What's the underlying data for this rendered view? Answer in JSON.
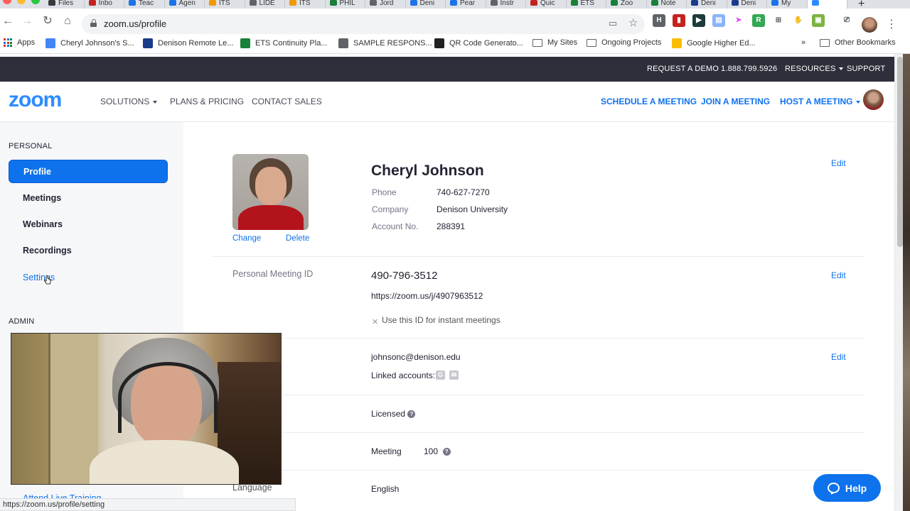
{
  "browser": {
    "tabs": [
      {
        "label": "Files",
        "color": "#3a3a3a"
      },
      {
        "label": "Inbo",
        "color": "#c5221f"
      },
      {
        "label": "Teac",
        "color": "#1a73e8"
      },
      {
        "label": "Agen",
        "color": "#1a73e8"
      },
      {
        "label": "ITS",
        "color": "#f29900"
      },
      {
        "label": "LIDE",
        "color": "#5f6368"
      },
      {
        "label": "ITS",
        "color": "#f29900"
      },
      {
        "label": "PHIL",
        "color": "#188038"
      },
      {
        "label": "Jord",
        "color": "#5f6368"
      },
      {
        "label": "Deni",
        "color": "#1a73e8"
      },
      {
        "label": "Pear",
        "color": "#1a73e8"
      },
      {
        "label": "Instr",
        "color": "#5f6368"
      },
      {
        "label": "Quic",
        "color": "#c5221f"
      },
      {
        "label": "ETS",
        "color": "#188038"
      },
      {
        "label": "Zoo",
        "color": "#188038"
      },
      {
        "label": "Note",
        "color": "#188038"
      },
      {
        "label": "Deni",
        "color": "#1a3a8a"
      },
      {
        "label": "Deni",
        "color": "#1a3a8a"
      },
      {
        "label": "My",
        "color": "#1a73e8"
      },
      {
        "label": "",
        "color": "#2d8cff"
      }
    ],
    "url": "zoom.us/profile",
    "bookmarks": [
      {
        "label": "Apps"
      },
      {
        "label": "Cheryl Johnson's S...",
        "color": "#4285f4"
      },
      {
        "label": "Denison Remote Le...",
        "color": "#1a3a8a"
      },
      {
        "label": "ETS Continuity Pla...",
        "color": "#188038"
      },
      {
        "label": "SAMPLE RESPONS...",
        "color": "#5f6368"
      },
      {
        "label": "QR Code Generato...",
        "color": "#222"
      },
      {
        "label": "My Sites"
      },
      {
        "label": "Ongoing Projects"
      },
      {
        "label": "Google Higher Ed...",
        "color": "#fbbc04"
      },
      {
        "label": "»"
      },
      {
        "label": "Other Bookmarks"
      }
    ],
    "status_url": "https://zoom.us/profile/setting"
  },
  "topbar": {
    "request_demo": "REQUEST A DEMO",
    "phone": "1.888.799.5926",
    "resources": "RESOURCES",
    "support": "SUPPORT"
  },
  "nav": {
    "logo": "zoom",
    "solutions": "SOLUTIONS",
    "plans": "PLANS & PRICING",
    "contact": "CONTACT SALES",
    "schedule": "SCHEDULE A MEETING",
    "join": "JOIN A MEETING",
    "host": "HOST A MEETING"
  },
  "sidebar": {
    "personal_heading": "PERSONAL",
    "items": [
      "Profile",
      "Meetings",
      "Webinars",
      "Recordings",
      "Settings"
    ],
    "admin_heading": "ADMIN",
    "partial_item": "Attend Live Training"
  },
  "profile": {
    "name": "Cheryl Johnson",
    "change": "Change",
    "delete": "Delete",
    "edit": "Edit",
    "fields": [
      {
        "label": "Phone",
        "value": "740-627-7270"
      },
      {
        "label": "Company",
        "value": "Denison University"
      },
      {
        "label": "Account No.",
        "value": "288391"
      }
    ],
    "pmi_label": "Personal Meeting ID",
    "pmi": "490-796-3512",
    "pmi_url": "https://zoom.us/j/4907963512",
    "pmi_instant": "Use this ID for instant meetings",
    "email": "johnsonc@denison.edu",
    "linked_label": "Linked accounts:",
    "license": "Licensed",
    "meeting_label": "Meeting",
    "meeting_capacity": "100",
    "language_label": "Language",
    "language": "English"
  },
  "help": {
    "label": "Help"
  },
  "colors": {
    "brand": "#2d8cff",
    "accent": "#0e72ed",
    "topbar": "#2d2f3a"
  }
}
